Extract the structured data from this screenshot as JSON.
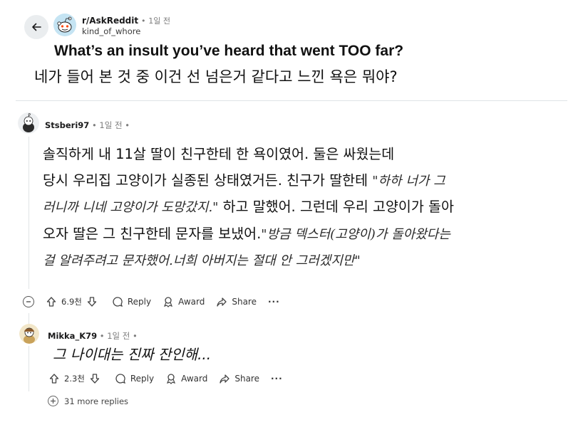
{
  "post": {
    "subreddit": "r/AskReddit",
    "separator": "•",
    "time": "1일 전",
    "author": "kind_of_whore",
    "title_en": "What’s an insult you’ve heard that went TOO far?",
    "title_ko": "네가 들어 본 것 중 이건 선 넘은거 같다고 느낀 욕은 뭐야?"
  },
  "comments": [
    {
      "author": "Stsberi97",
      "separator": "•",
      "time": "1일 전",
      "trail": "•",
      "body_lines": [
        "솔직하게 내 11살 딸이 친구한테 한 욕이였어. 둘은 싸웠는데",
        "당시 우리집 고양이가 실종된 상태였거든. 친구가 딸한테",
        "러니까 니네 고양이가 도망갔지.",
        "하고 말했어. 그런데 우리 고양이가 돌아",
        "오자 딸은 그 친구한테 문자를 보냈어.",
        "걸 알려주려고 문자했어.너희 아버지는 절대 안 그러겠지만"
      ],
      "quote_a": "\"하하 너가 그",
      "quote_b": "\"방금 덱스터(고양이)가 돌아왔다는",
      "quote_end": "\"",
      "votes": "6.9천",
      "reply": "Reply",
      "award": "Award",
      "share": "Share",
      "more": "···"
    },
    {
      "author": "Mikka_K79",
      "separator": "•",
      "time": "1일 전",
      "trail": "•",
      "body": "그 나이대는 진짜 잔인해...",
      "votes": "2.3천",
      "reply": "Reply",
      "award": "Award",
      "share": "Share",
      "more": "···"
    }
  ],
  "more_replies": "31 more replies",
  "colors": {
    "accent": "#ff4500",
    "muted": "#7c7c7c",
    "line": "#e1e4e6"
  },
  "icons": [
    "back-arrow-icon",
    "upvote-icon",
    "downvote-icon",
    "comment-icon",
    "award-icon",
    "share-icon",
    "collapse-icon",
    "plus-icon"
  ]
}
